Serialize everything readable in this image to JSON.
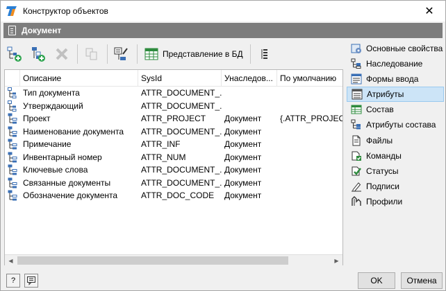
{
  "window": {
    "title": "Конструктор объектов",
    "close": "✕"
  },
  "header": {
    "title": "Документ"
  },
  "toolbar": {
    "db_view_label": "Представление в БД"
  },
  "grid": {
    "columns": [
      "Описание",
      "SysId",
      "Унаследов...",
      "По умолчанию"
    ],
    "rows": [
      {
        "icon": "tree-attr-icon",
        "desc": "Тип документа",
        "sysid": "ATTR_DOCUMENT_...",
        "inherited": "",
        "default": ""
      },
      {
        "icon": "tree-attr-icon",
        "desc": "Утверждающий",
        "sysid": "ATTR_DOCUMENT_...",
        "inherited": "",
        "default": ""
      },
      {
        "icon": "object-attr-icon",
        "desc": "Проект",
        "sysid": "ATTR_PROJECT",
        "inherited": "Документ",
        "default": "{.ATTR_PROJECT}"
      },
      {
        "icon": "object-attr-icon",
        "desc": "Наименование документа",
        "sysid": "ATTR_DOCUMENT_...",
        "inherited": "Документ",
        "default": ""
      },
      {
        "icon": "object-attr-icon",
        "desc": "Примечание",
        "sysid": "ATTR_INF",
        "inherited": "Документ",
        "default": ""
      },
      {
        "icon": "object-attr-icon",
        "desc": "Инвентарный номер",
        "sysid": "ATTR_NUM",
        "inherited": "Документ",
        "default": ""
      },
      {
        "icon": "object-attr-icon",
        "desc": "Ключевые слова",
        "sysid": "ATTR_DOCUMENT_...",
        "inherited": "Документ",
        "default": ""
      },
      {
        "icon": "object-attr-icon",
        "desc": "Связанные документы",
        "sysid": "ATTR_DOCUMENT_...",
        "inherited": "Документ",
        "default": ""
      },
      {
        "icon": "object-attr-icon",
        "desc": "Обозначение документа",
        "sysid": "ATTR_DOC_CODE",
        "inherited": "Документ",
        "default": ""
      }
    ]
  },
  "sidebar": {
    "items": [
      {
        "label": "Основные свойства",
        "icon": "properties-icon",
        "active": false
      },
      {
        "label": "Наследование",
        "icon": "inheritance-icon",
        "active": false
      },
      {
        "label": "Формы ввода",
        "icon": "forms-icon",
        "active": false
      },
      {
        "label": "Атрибуты",
        "icon": "attributes-icon",
        "active": true
      },
      {
        "label": "Состав",
        "icon": "composition-icon",
        "active": false
      },
      {
        "label": "Атрибуты состава",
        "icon": "composition-attributes-icon",
        "active": false
      },
      {
        "label": "Файлы",
        "icon": "files-icon",
        "active": false
      },
      {
        "label": "Команды",
        "icon": "commands-icon",
        "active": false
      },
      {
        "label": "Статусы",
        "icon": "statuses-icon",
        "active": false
      },
      {
        "label": "Подписи",
        "icon": "signatures-icon",
        "active": false
      },
      {
        "label": "Профили",
        "icon": "profiles-icon",
        "active": false
      }
    ]
  },
  "buttons": {
    "ok": "OK",
    "cancel": "Отмена",
    "help": "?"
  }
}
